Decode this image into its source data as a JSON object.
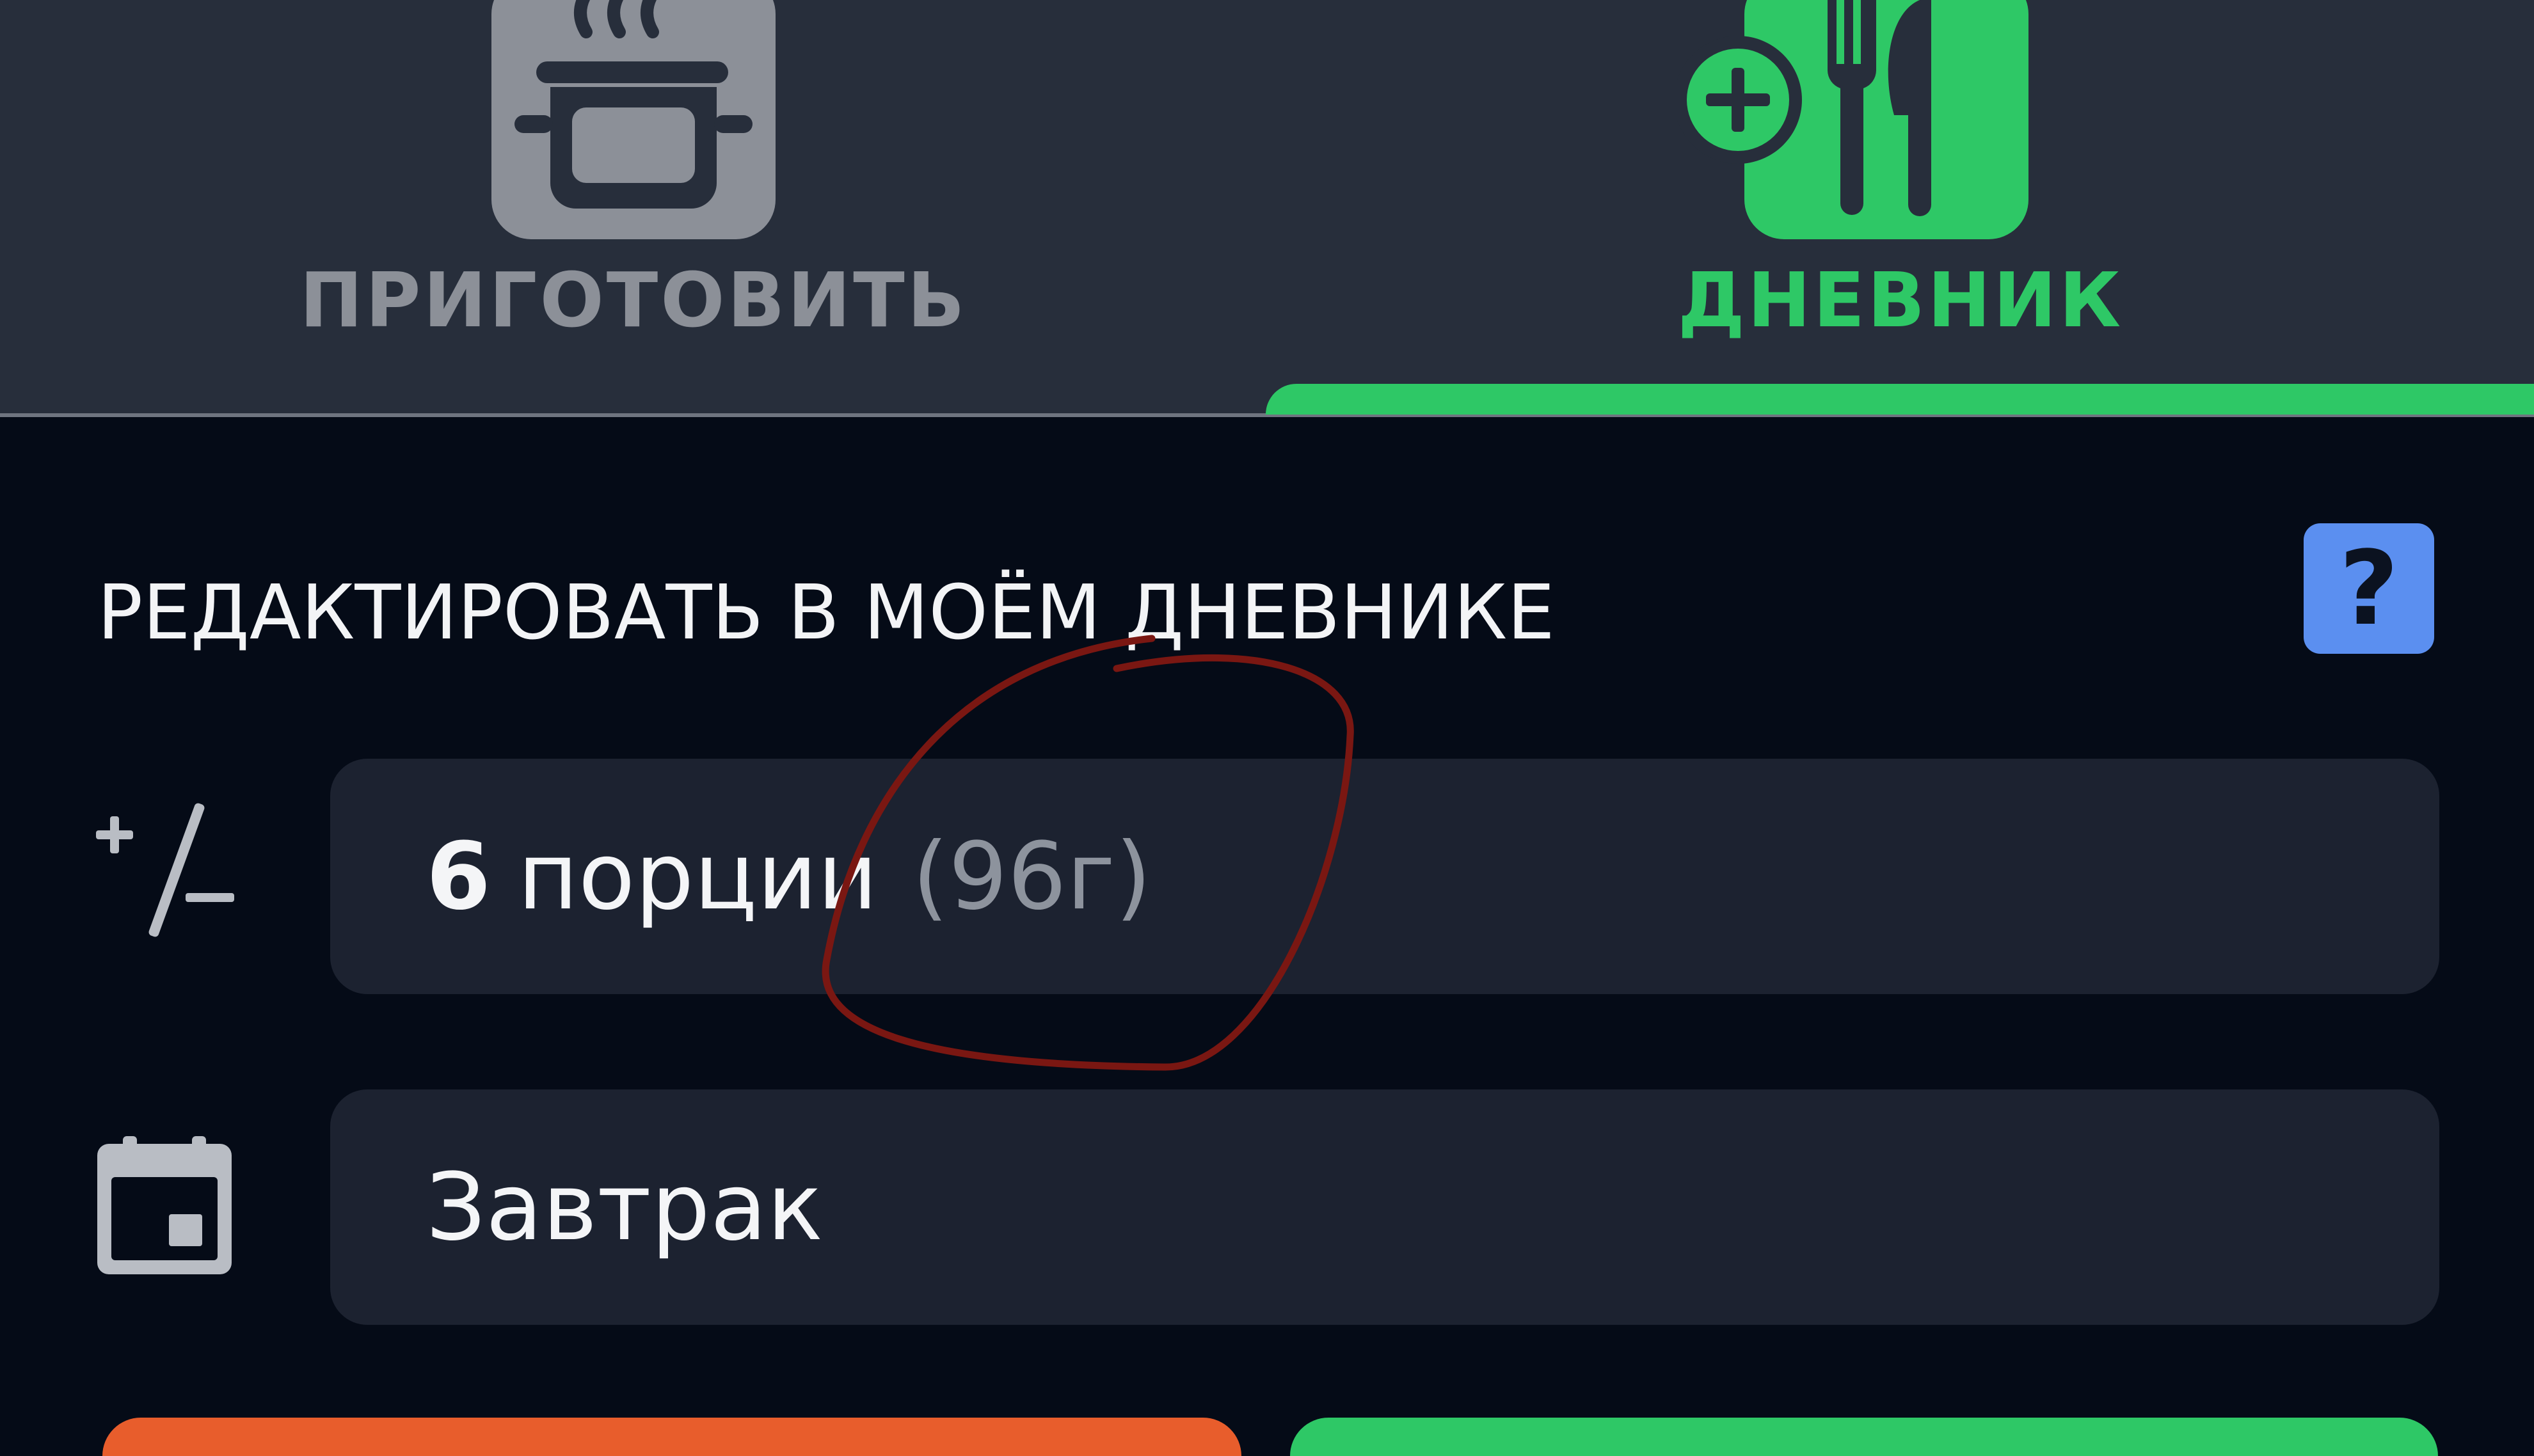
{
  "tabs": [
    {
      "label": "ПРИГОТОВИТЬ",
      "icon": "cooking-pot-icon",
      "active": false
    },
    {
      "label": "ДНЕВНИК",
      "icon": "diary-add-cutlery-icon",
      "active": true
    }
  ],
  "section": {
    "title": "РЕДАКТИРОВАТЬ В МОЁМ ДНЕВНИКЕ",
    "help_label": "?"
  },
  "portions": {
    "icon": "plus-minus-icon",
    "quantity": "6",
    "unit": "порции",
    "weight": "(96г)"
  },
  "meal": {
    "icon": "calendar-icon",
    "value": "Завтрак"
  },
  "colors": {
    "accent_green": "#2ec866",
    "help_blue": "#5b8ff0",
    "cancel_orange": "#e85d2c",
    "annotation_red": "#7a1712"
  }
}
